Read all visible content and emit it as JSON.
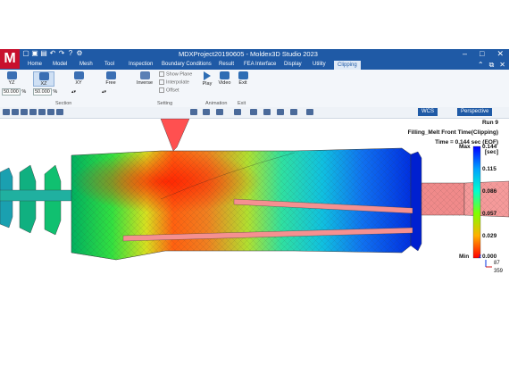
{
  "app": {
    "logo": "M",
    "window_title": "MDXProject20190605 - Moldex3D Studio 2023",
    "quick_access": [
      "new-icon",
      "save-icon",
      "open-icon",
      "undo-icon",
      "redo-icon",
      "help-icon",
      "settings-icon"
    ]
  },
  "tabs": [
    "Home",
    "Model",
    "Mesh",
    "Tool",
    "Inspection",
    "Boundary Conditions",
    "Result",
    "FEA Interface",
    "Display",
    "Utility",
    "Clipping"
  ],
  "active_tab": "Clipping",
  "ribbon": {
    "section": {
      "label": "Section",
      "buttons": [
        "YZ",
        "XZ",
        "XY",
        "Free"
      ],
      "values": [
        "50.000",
        "50.000",
        "%",
        "%"
      ]
    },
    "setting": {
      "label": "Setting",
      "inverse": "Inverse",
      "options": [
        "Show Plane",
        "Interpolate",
        "Offset"
      ]
    },
    "animation": {
      "label": "Animation",
      "buttons": [
        "Play",
        "Video"
      ]
    },
    "exit": {
      "label": "Exit",
      "button": "Exit"
    }
  },
  "toolbar": {
    "coord_system": "WCS",
    "projection": "Perspective"
  },
  "result": {
    "run": "Run 9",
    "title": "Filling_Melt Front Time(Clipping)",
    "time": "Time = 0.144 sec (EOF)",
    "unit": "[sec]"
  },
  "legend": {
    "max_label": "Max",
    "min_label": "Min",
    "ticks": [
      "0.144",
      "0.115",
      "0.086",
      "0.057",
      "0.029",
      "0.000"
    ],
    "colors": [
      "#0000ff",
      "#00c0ff",
      "#00ff80",
      "#ffff00",
      "#ff8000",
      "#ff0000"
    ]
  },
  "triad": {
    "z_label": "z",
    "value_1": "87",
    "value_2": "359"
  }
}
